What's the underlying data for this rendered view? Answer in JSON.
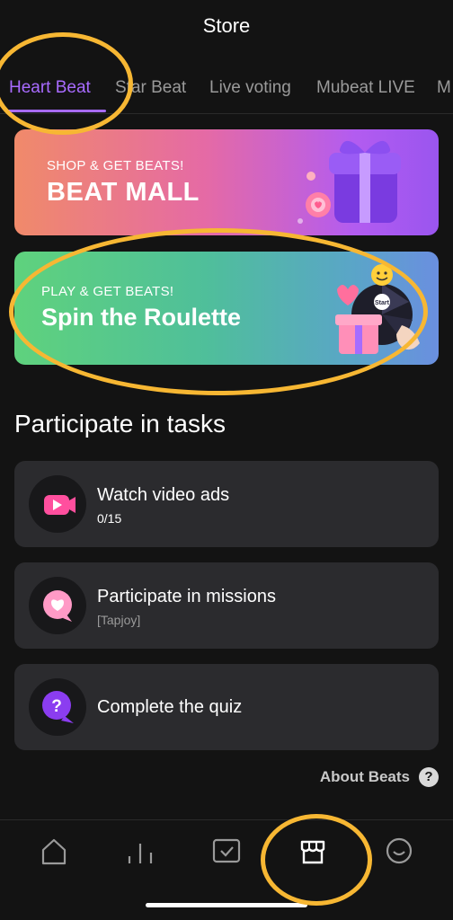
{
  "header": {
    "title": "Store"
  },
  "tabs": [
    {
      "label": "Heart Beat",
      "active": true
    },
    {
      "label": "Star Beat",
      "active": false
    },
    {
      "label": "Live voting",
      "active": false
    },
    {
      "label": "Mubeat LIVE",
      "active": false
    },
    {
      "label": "M",
      "active": false
    }
  ],
  "banners": {
    "mall": {
      "kicker": "SHOP & GET BEATS!",
      "title": "BEAT MALL"
    },
    "roulette": {
      "kicker": "PLAY & GET BEATS!",
      "title": "Spin the Roulette",
      "wheel_label": "Start"
    }
  },
  "tasks_section": {
    "title": "Participate in tasks"
  },
  "tasks": [
    {
      "title": "Watch video ads",
      "subtitle": "0/15",
      "icon": "video-play-icon"
    },
    {
      "title": "Participate in missions",
      "subtitle": "[Tapjoy]",
      "icon": "heart-bubble-icon"
    },
    {
      "title": "Complete the quiz",
      "subtitle": "",
      "icon": "question-bubble-icon"
    }
  ],
  "about": {
    "label": "About Beats",
    "help_glyph": "?"
  },
  "bottom_nav": [
    {
      "name": "home",
      "icon": "home-icon"
    },
    {
      "name": "chart",
      "icon": "chart-icon"
    },
    {
      "name": "vote",
      "icon": "checkbox-icon"
    },
    {
      "name": "store",
      "icon": "store-icon",
      "active": true
    },
    {
      "name": "profile",
      "icon": "smiley-icon"
    }
  ],
  "colors": {
    "accent": "#a86bff",
    "background": "#131313",
    "card": "#2b2b2e",
    "annotation": "#f7b733"
  }
}
